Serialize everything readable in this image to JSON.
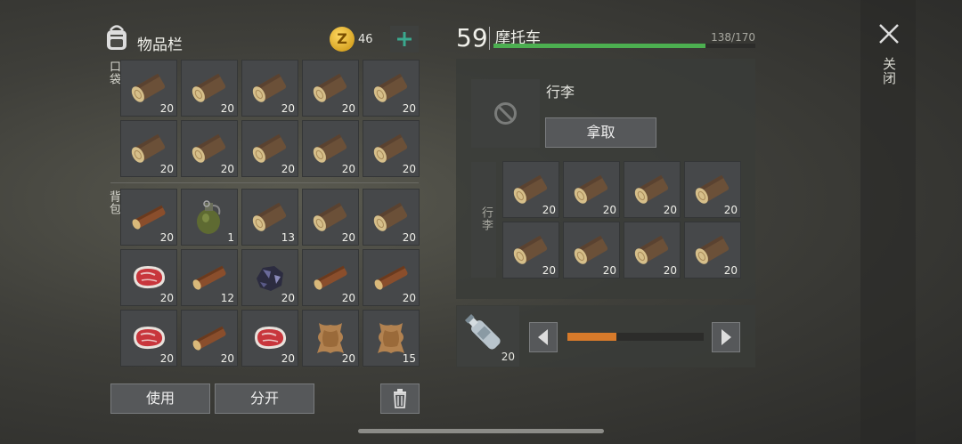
{
  "inventory": {
    "title": "物品栏",
    "coins": "46",
    "coin_symbol": "Z",
    "pocket_label": "口袋",
    "backpack_label": "背包",
    "pocket": [
      {
        "icon": "log",
        "count": "20"
      },
      {
        "icon": "log",
        "count": "20"
      },
      {
        "icon": "log",
        "count": "20"
      },
      {
        "icon": "log",
        "count": "20"
      },
      {
        "icon": "log",
        "count": "20"
      },
      {
        "icon": "log",
        "count": "20"
      },
      {
        "icon": "log",
        "count": "20"
      },
      {
        "icon": "log",
        "count": "20"
      },
      {
        "icon": "log",
        "count": "20"
      },
      {
        "icon": "log",
        "count": "20"
      }
    ],
    "backpack": [
      {
        "icon": "branch",
        "count": "20"
      },
      {
        "icon": "grenade",
        "count": "1"
      },
      {
        "icon": "log",
        "count": "13"
      },
      {
        "icon": "log",
        "count": "20"
      },
      {
        "icon": "log",
        "count": "20"
      },
      {
        "icon": "steak",
        "count": "20"
      },
      {
        "icon": "branch",
        "count": "12"
      },
      {
        "icon": "ore",
        "count": "20"
      },
      {
        "icon": "branch",
        "count": "20"
      },
      {
        "icon": "branch",
        "count": "20"
      },
      {
        "icon": "steak",
        "count": "20"
      },
      {
        "icon": "branch",
        "count": "20"
      },
      {
        "icon": "steak",
        "count": "20"
      },
      {
        "icon": "hide",
        "count": "20"
      },
      {
        "icon": "hide",
        "count": "15"
      }
    ],
    "use_label": "使用",
    "split_label": "分开"
  },
  "vehicle": {
    "level": "59",
    "name": "摩托车",
    "durability": "138/170",
    "durability_fraction": 0.81,
    "luggage_label": "行李",
    "take_label": "拿取",
    "storage_label": "行李",
    "storage": [
      {
        "icon": "log",
        "count": "20"
      },
      {
        "icon": "log",
        "count": "20"
      },
      {
        "icon": "log",
        "count": "20"
      },
      {
        "icon": "log",
        "count": "20"
      },
      {
        "icon": "log",
        "count": "20"
      },
      {
        "icon": "log",
        "count": "20"
      },
      {
        "icon": "log",
        "count": "20"
      },
      {
        "icon": "log",
        "count": "20"
      }
    ],
    "fuel_count": "20",
    "fuel_fraction": 0.36
  },
  "close_label": "关闭",
  "colors": {
    "accent_green": "#4caf50",
    "fuel_orange": "#d77a2a",
    "coin": "#e8b21c"
  }
}
